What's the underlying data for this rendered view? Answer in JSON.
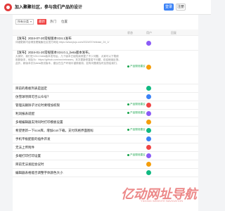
{
  "header": {
    "title": "加入聚聚社区，参与我们产品的设计",
    "login_label": "登录",
    "register_label": "注册"
  },
  "filters": {
    "select_value": "所有分类",
    "tabs": [
      "最新",
      "热门",
      "位置"
    ]
  },
  "columns": [
    "状态",
    "用户",
    "回复"
  ],
  "rows": [
    {
      "title": "【发布】2024-07-20常规版本V24.1发布",
      "excerpt": "详细更新内容请查看聚聚社区官方网站 https://www.jiuju.com/2024/07/release_24_1/",
      "status": "",
      "avatar": "c1",
      "meta": "",
      "height": 20
    },
    {
      "title": "【发布】2024-01-20常规版本V24.0.1_beta版本发布。",
      "excerpt": "大家好，我们在V24.0 beta版本发布后，几个版本已经陆续修复了不少问题，大家可以下载使用新版本，地址为：https://github.com/xxx/releases；本次更新修复若干问题，欢迎继续反馈。此外，新版本仍为beta测试版本，建议在生产环境中谨慎使用，如有问题请及时反馈给我们。",
      "status": "产品规划建议",
      "avatar": "c2",
      "meta": "",
      "height": 48
    },
    {
      "title": "目前的看板列表是固定",
      "excerpt": "",
      "status": "",
      "avatar": "c3",
      "meta": "",
      "height": 12
    },
    {
      "title": "仿雪球项目可否公众号？",
      "excerpt": "",
      "status": "",
      "avatar": "c4",
      "meta": "",
      "height": 12
    },
    {
      "title": "管理员删除子讨论时要增加权限",
      "excerpt": "",
      "status": "产品规划建议",
      "avatar": "c5",
      "meta": "",
      "height": 12
    },
    {
      "title": "利润报表适配",
      "excerpt": "",
      "status": "产品规划建议",
      "avatar": "c1",
      "meta": "",
      "height": 12
    },
    {
      "title": "多端编辑器支持同时打印模板设置",
      "excerpt": "",
      "status": "",
      "avatar": "c2",
      "meta": "",
      "height": 12
    },
    {
      "title": "希望更新一下icon库，增加icon下载，支付风格界面图标",
      "excerpt": "",
      "status": "产品规划建议",
      "avatar": "c3",
      "meta": "",
      "height": 12
    },
    {
      "title": "手机平板配套的插件开发",
      "excerpt": "",
      "status": "",
      "avatar": "c4",
      "meta": "",
      "height": 12
    },
    {
      "title": "无法上传附件",
      "excerpt": "",
      "status": "",
      "avatar": "c5",
      "meta": "",
      "height": 12
    },
    {
      "title": "多端打印打印设置",
      "excerpt": "",
      "status": "产品规划建议",
      "avatar": "c1",
      "meta": "",
      "height": 12
    },
    {
      "title": "目前无法发起会议时",
      "excerpt": "",
      "status": "",
      "avatar": "c2",
      "meta": "",
      "height": 12
    },
    {
      "title": "编辑器表格能否调整字体颜色大小",
      "excerpt": "",
      "status": "",
      "avatar": "c3",
      "meta": "",
      "height": 12
    }
  ],
  "watermark": {
    "text": "亿动网址导航",
    "sub": "YIDONG WEBSITE NAVIGATION"
  }
}
